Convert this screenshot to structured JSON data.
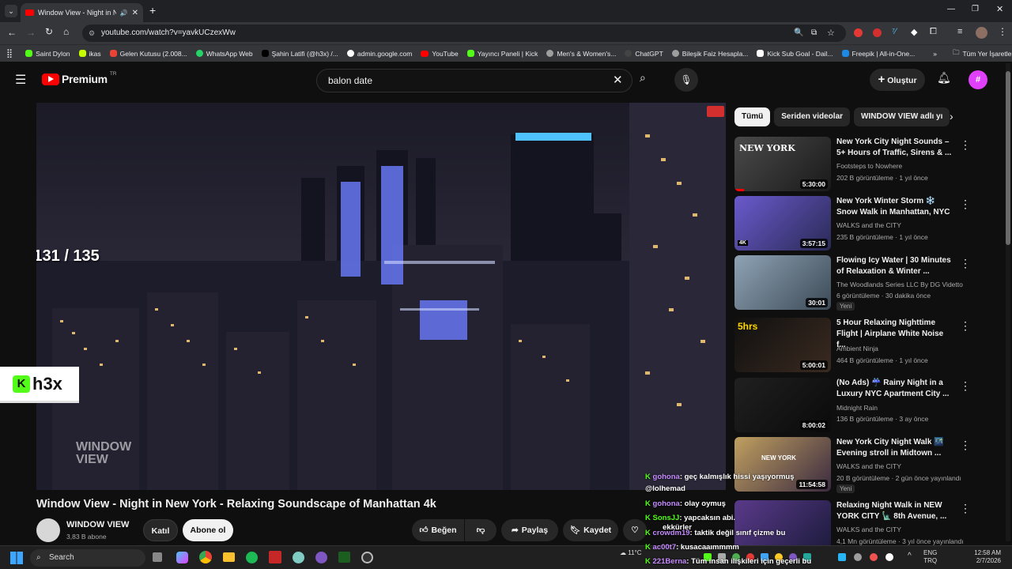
{
  "browser": {
    "tab_title": "Window View - Night in Ne",
    "url": "youtube.com/watch?v=yavkUCzexWw",
    "bookmarks": [
      "Saint Dylon",
      "ikas",
      "Gelen Kutusu (2.008...",
      "WhatsApp Web",
      "Şahin Latifi (@h3x) /...",
      "admin.google.com",
      "YouTube",
      "Yayıncı Paneli | Kick",
      "Men's & Women's...",
      "ChatGPT",
      "Bileşik Faiz Hesapla...",
      "Kick Sub Goal - Dail...",
      "Freepik | All-in-One..."
    ],
    "all_bookmarks": "Tüm Yer İşaretleri",
    "colors": {
      "tab_bg": "#35363a",
      "frame": "#202124"
    }
  },
  "yt": {
    "logo_text": "Premium",
    "region": "TR",
    "search_value": "balon date",
    "create_label": "Oluştur",
    "brand_color": "#ff0000"
  },
  "overlay": {
    "counter": "131 / 135",
    "streamer": "h3x",
    "watermark_line1": "WINDOW",
    "watermark_line2": "VIEW"
  },
  "video": {
    "title": "Window View - Night in New York - Relaxing Soundscape of Manhattan 4k",
    "channel": "WINDOW VIEW",
    "subs": "3,83 B abone",
    "join": "Katıl",
    "subscribe": "Abone ol",
    "like": "Beğen",
    "share": "Paylaş",
    "save": "Kaydet"
  },
  "chips": [
    "Tümü",
    "Seriden videolar",
    "WINDOW VIEW adlı yı"
  ],
  "recs": [
    {
      "title": "New York City Night Sounds – 5+ Hours of Traffic, Sirens & ...",
      "channel": "Footsteps to Nowhere",
      "meta": "202 B görüntüleme · 1 yıl önce",
      "dur": "5:30:00",
      "badge": "",
      "thumb": "NEW YORK"
    },
    {
      "title": "New York Winter Storm ❄️ Snow Walk in Manhattan, NYC",
      "channel": "WALKS and the CITY",
      "meta": "235 B görüntüleme · 1 yıl önce",
      "dur": "3:57:15",
      "badge": "",
      "thumb": "4K"
    },
    {
      "title": "Flowing Icy Water | 30 Minutes of Relaxation & Winter ...",
      "channel": "The Woodlands Series LLC By DG Videtto",
      "meta": "6 görüntüleme · 30 dakika önce",
      "dur": "30:01",
      "badge": "Yeni",
      "thumb": ""
    },
    {
      "title": "5 Hour Relaxing Nighttime Flight | Airplane White Noise f...",
      "channel": "Ambient Ninja",
      "meta": "464 B görüntüleme · 1 yıl önce",
      "dur": "5:00:01",
      "badge": "",
      "thumb": "5hrs"
    },
    {
      "title": "(No Ads) ☔ Rainy Night in a Luxury NYC Apartment  City ...",
      "channel": "Midnight Rain",
      "meta": "136 B görüntüleme · 3 ay önce",
      "dur": "8:00:02",
      "badge": "",
      "thumb": ""
    },
    {
      "title": "New York City Night Walk 🌃 Evening stroll in Midtown ...",
      "channel": "WALKS and the CITY",
      "meta": "20 B görüntüleme · 2 gün önce yayınlandı",
      "dur": "11:54:58",
      "badge": "Yeni",
      "thumb": "NEW YORK"
    },
    {
      "title": "Relaxing Night Walk in NEW YORK CITY 🗽 8th Avenue, ...",
      "channel": "WALKS and the CITY",
      "meta": "4,1 Mn görüntüleme · 3 yıl önce yayınlandı",
      "dur": "",
      "badge": "",
      "thumb": ""
    }
  ],
  "chat": [
    {
      "user": "gohona",
      "color": "#c58bff",
      "text": ": geç kalmışlık hissi yaşıyormuş"
    },
    {
      "user": "",
      "color": "#fff",
      "text": "@lolhemad"
    },
    {
      "user": "gohona",
      "color": "#c58bff",
      "text": ": olay oymuş"
    },
    {
      "user": "SonsJJ",
      "color": "#53fc18",
      "text": ": yapcaksın abi."
    },
    {
      "user": "crowdm19",
      "color": "#c58bff",
      "text": ": taktik değil sınıf çizme bu"
    },
    {
      "user": "ac00t7",
      "color": "#c58bff",
      "text": ": kusacaaımmmm"
    },
    {
      "user": "221Berna",
      "color": "#c58bff",
      "text": ": Tüm insan ilişkileri için geçerli bu"
    }
  ],
  "chat_extra": "ekkürler",
  "taskbar": {
    "search": "Search",
    "weather": "11°C",
    "lang1": "ENG",
    "lang2": "TRQ",
    "time": "12:58 AM",
    "date": "2/7/2026"
  }
}
